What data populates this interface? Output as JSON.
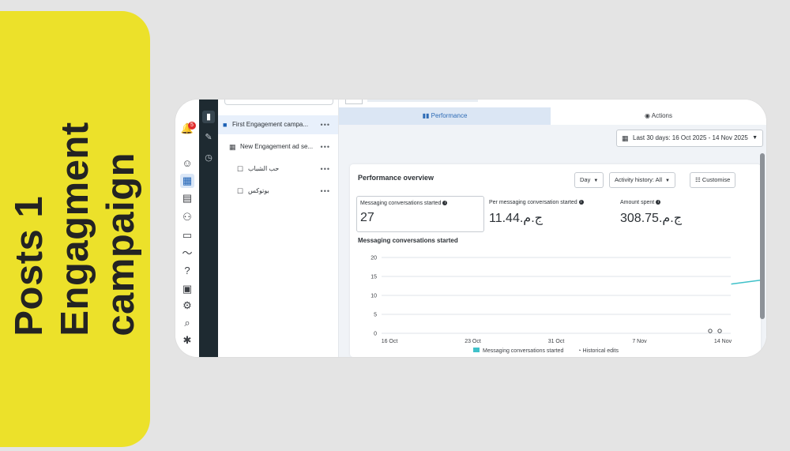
{
  "title_card": {
    "lines": [
      "Posts 1",
      "Engagment",
      "campaign"
    ],
    "background": "#ece12a"
  },
  "icon_rail": {
    "notification_count": "5",
    "items": [
      "bell-icon",
      "smiley-icon",
      "grid-table-icon",
      "document-icon",
      "people-icon",
      "card-icon",
      "trend-icon",
      "help-icon",
      "report-icon",
      "gear-icon",
      "search-icon",
      "bug-icon"
    ]
  },
  "side_toolbar": {
    "items": [
      "chart-icon",
      "pencil-icon",
      "clock-icon"
    ]
  },
  "tree": {
    "rows": [
      {
        "label": "First Engagement campa...",
        "more": "•••"
      },
      {
        "label": "New Engagement ad se...",
        "more": "•••"
      },
      {
        "label": "حب الشباب",
        "more": "•••"
      },
      {
        "label": "بوتوكس",
        "more": "•••"
      }
    ]
  },
  "tabs": {
    "performance": "Performance",
    "actions": "Actions"
  },
  "date_range": "Last 30 days: 16 Oct 2025 - 14 Nov 2025",
  "performance": {
    "title": "Performance overview",
    "day_label": "Day",
    "activity_label": "Activity history: All",
    "customise_label": "Customise",
    "metrics": [
      {
        "label": "Messaging conversations started",
        "value": "27"
      },
      {
        "label": "Per messaging conversation started",
        "value": "11.44.ج.م"
      },
      {
        "label": "Amount spent",
        "value": "308.75.ج.م"
      }
    ],
    "chart_title": "Messaging conversations started"
  },
  "chart_data": {
    "type": "line",
    "title": "Messaging conversations started",
    "xlabel": "",
    "ylabel": "",
    "x": [
      "16 Oct",
      "23 Oct",
      "31 Oct",
      "7 Nov",
      "14 Nov"
    ],
    "yticks": [
      0,
      5,
      10,
      15,
      20
    ],
    "ylim": [
      0,
      20
    ],
    "series": [
      {
        "name": "Messaging conversations started",
        "color": "#3fc1c9",
        "x_index": [
          4.1,
          4.45
        ],
        "values": [
          13,
          14
        ]
      }
    ],
    "legend": [
      "Messaging conversations started",
      "Historical edits"
    ],
    "grid": true
  }
}
